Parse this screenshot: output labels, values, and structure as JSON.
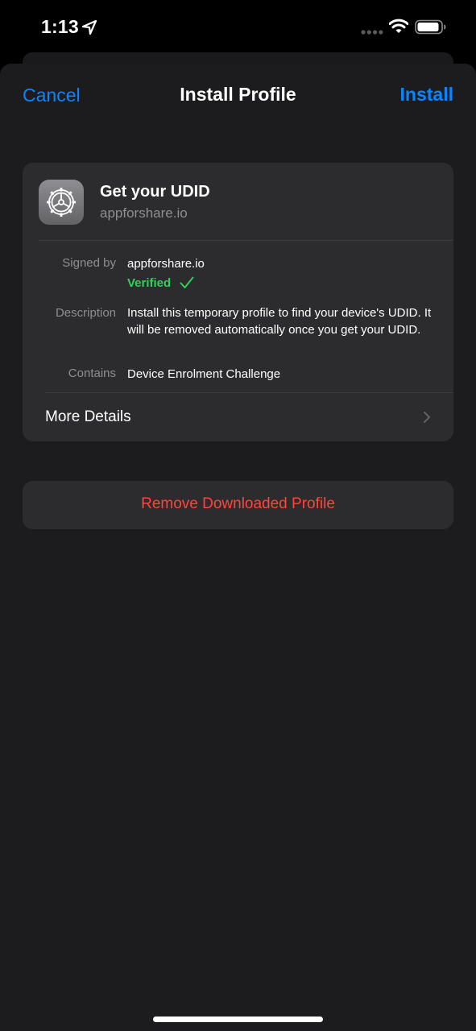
{
  "status_bar": {
    "time": "1:13",
    "icons": [
      "location-arrow-icon",
      "signal-dots-icon",
      "wifi-icon",
      "battery-icon"
    ]
  },
  "nav": {
    "cancel_label": "Cancel",
    "title": "Install Profile",
    "install_label": "Install"
  },
  "profile": {
    "icon": "settings-gear-icon",
    "name": "Get your UDID",
    "domain": "appforshare.io"
  },
  "details": {
    "signed_by_label": "Signed by",
    "signed_by_value": "appforshare.io",
    "verified_label": "Verified",
    "description_label": "Description",
    "description_value": "Install this temporary profile to find your device's UDID. It will be removed automatically once you get your UDID.",
    "contains_label": "Contains",
    "contains_value": "Device Enrolment Challenge"
  },
  "more_details_label": "More Details",
  "remove_label": "Remove Downloaded Profile",
  "colors": {
    "accent": "#0a84ff",
    "verified": "#30d158",
    "destructive": "#ff453a",
    "sheet_bg": "#1c1c1e",
    "card_bg": "#2c2c2e"
  }
}
